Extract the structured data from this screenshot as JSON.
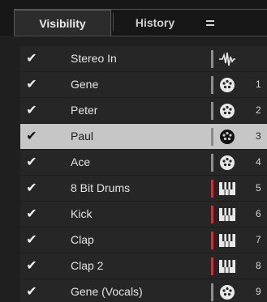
{
  "tabs": {
    "visibility": "Visibility",
    "history": "History"
  },
  "tracks": [
    {
      "name": "Stereo In",
      "checked": "✔",
      "icon": "waveform-icon",
      "number": "",
      "stripe": "gray"
    },
    {
      "name": "Gene",
      "checked": "✔",
      "icon": "drum-pad-icon",
      "number": "1",
      "stripe": "gray"
    },
    {
      "name": "Peter",
      "checked": "✔",
      "icon": "drum-pad-icon",
      "number": "2",
      "stripe": "gray"
    },
    {
      "name": "Paul",
      "checked": "✔",
      "icon": "drum-pad-icon",
      "number": "3",
      "stripe": "gray",
      "selected": true
    },
    {
      "name": "Ace",
      "checked": "✔",
      "icon": "drum-pad-icon",
      "number": "4",
      "stripe": "gray"
    },
    {
      "name": "8 Bit Drums",
      "checked": "✔",
      "icon": "piano-keys-icon",
      "number": "5",
      "stripe": "red"
    },
    {
      "name": "Kick",
      "checked": "✔",
      "icon": "piano-keys-icon",
      "number": "6",
      "stripe": "red"
    },
    {
      "name": "Clap",
      "checked": "✔",
      "icon": "piano-keys-icon",
      "number": "7",
      "stripe": "red"
    },
    {
      "name": "Clap 2",
      "checked": "✔",
      "icon": "piano-keys-icon",
      "number": "8",
      "stripe": "red"
    },
    {
      "name": "Gene (Vocals)",
      "checked": "✔",
      "icon": "drum-pad-icon",
      "number": "9",
      "stripe": "gray"
    }
  ],
  "colors": {
    "background": "#1f1f1f",
    "row": "#262626",
    "selected_row": "#c6c6c6",
    "midi_stripe": "#c8323a",
    "audio_stripe": "#8e8e8e"
  }
}
